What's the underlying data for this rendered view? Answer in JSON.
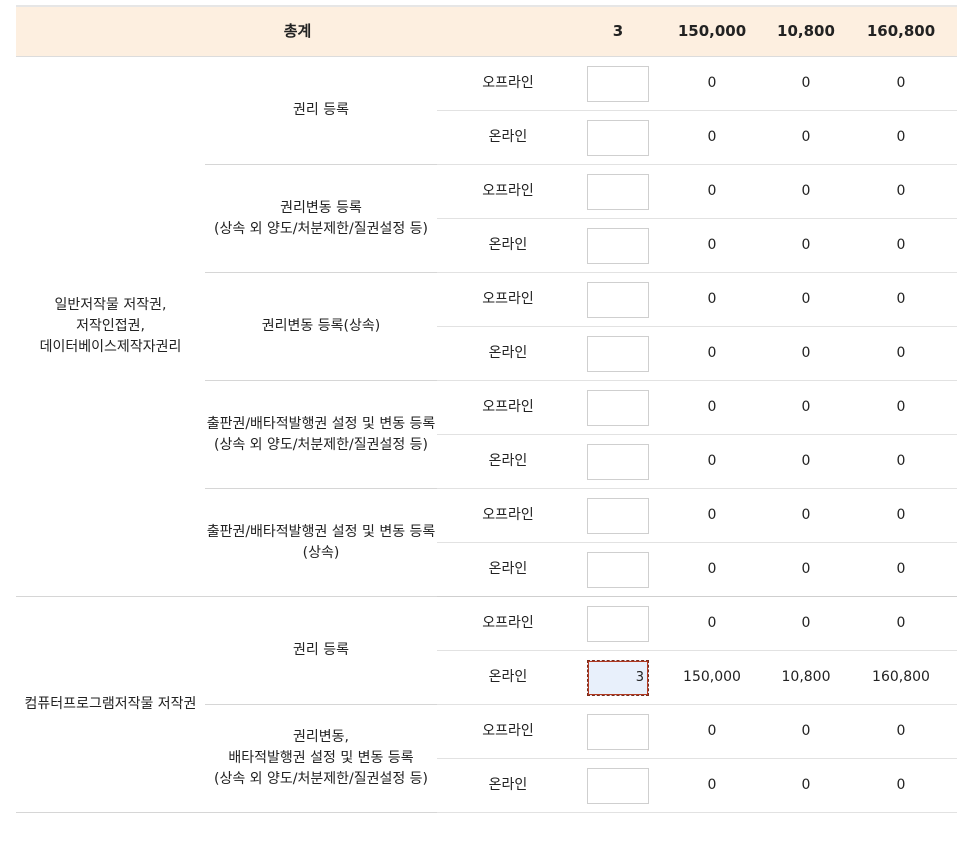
{
  "total": {
    "label": "총계",
    "qty": "3",
    "fee": "150,000",
    "tax": "10,800",
    "sum": "160,800"
  },
  "methods": {
    "offline": "오프라인",
    "online": "온라인"
  },
  "groups": [
    {
      "name": "일반저작물 저작권,\n저작인접권,\n데이터베이스제작자권리",
      "items": [
        {
          "label": "권리 등록",
          "rows": [
            {
              "method": "오프라인",
              "qty": "",
              "fee": "0",
              "tax": "0",
              "sum": "0"
            },
            {
              "method": "온라인",
              "qty": "",
              "fee": "0",
              "tax": "0",
              "sum": "0"
            }
          ]
        },
        {
          "label": "권리변동 등록\n(상속 외 양도/처분제한/질권설정 등)",
          "rows": [
            {
              "method": "오프라인",
              "qty": "",
              "fee": "0",
              "tax": "0",
              "sum": "0"
            },
            {
              "method": "온라인",
              "qty": "",
              "fee": "0",
              "tax": "0",
              "sum": "0"
            }
          ]
        },
        {
          "label": "권리변동 등록(상속)",
          "rows": [
            {
              "method": "오프라인",
              "qty": "",
              "fee": "0",
              "tax": "0",
              "sum": "0"
            },
            {
              "method": "온라인",
              "qty": "",
              "fee": "0",
              "tax": "0",
              "sum": "0"
            }
          ]
        },
        {
          "label": "출판권/배타적발행권 설정 및 변동 등록\n(상속 외 양도/처분제한/질권설정 등)",
          "rows": [
            {
              "method": "오프라인",
              "qty": "",
              "fee": "0",
              "tax": "0",
              "sum": "0"
            },
            {
              "method": "온라인",
              "qty": "",
              "fee": "0",
              "tax": "0",
              "sum": "0"
            }
          ]
        },
        {
          "label": "출판권/배타적발행권 설정 및 변동 등록\n(상속)",
          "rows": [
            {
              "method": "오프라인",
              "qty": "",
              "fee": "0",
              "tax": "0",
              "sum": "0"
            },
            {
              "method": "온라인",
              "qty": "",
              "fee": "0",
              "tax": "0",
              "sum": "0"
            }
          ]
        }
      ]
    },
    {
      "name": "컴퓨터프로그램저작물 저작권",
      "items": [
        {
          "label": "권리 등록",
          "rows": [
            {
              "method": "오프라인",
              "qty": "",
              "fee": "0",
              "tax": "0",
              "sum": "0"
            },
            {
              "method": "온라인",
              "qty": "3",
              "fee": "150,000",
              "tax": "10,800",
              "sum": "160,800"
            }
          ]
        },
        {
          "label": "권리변동,\n배타적발행권 설정 및 변동 등록\n(상속 외 양도/처분제한/질권설정 등)",
          "rows": [
            {
              "method": "오프라인",
              "qty": "",
              "fee": "0",
              "tax": "0",
              "sum": "0"
            },
            {
              "method": "온라인",
              "qty": "",
              "fee": "0",
              "tax": "0",
              "sum": "0"
            }
          ]
        }
      ]
    }
  ]
}
